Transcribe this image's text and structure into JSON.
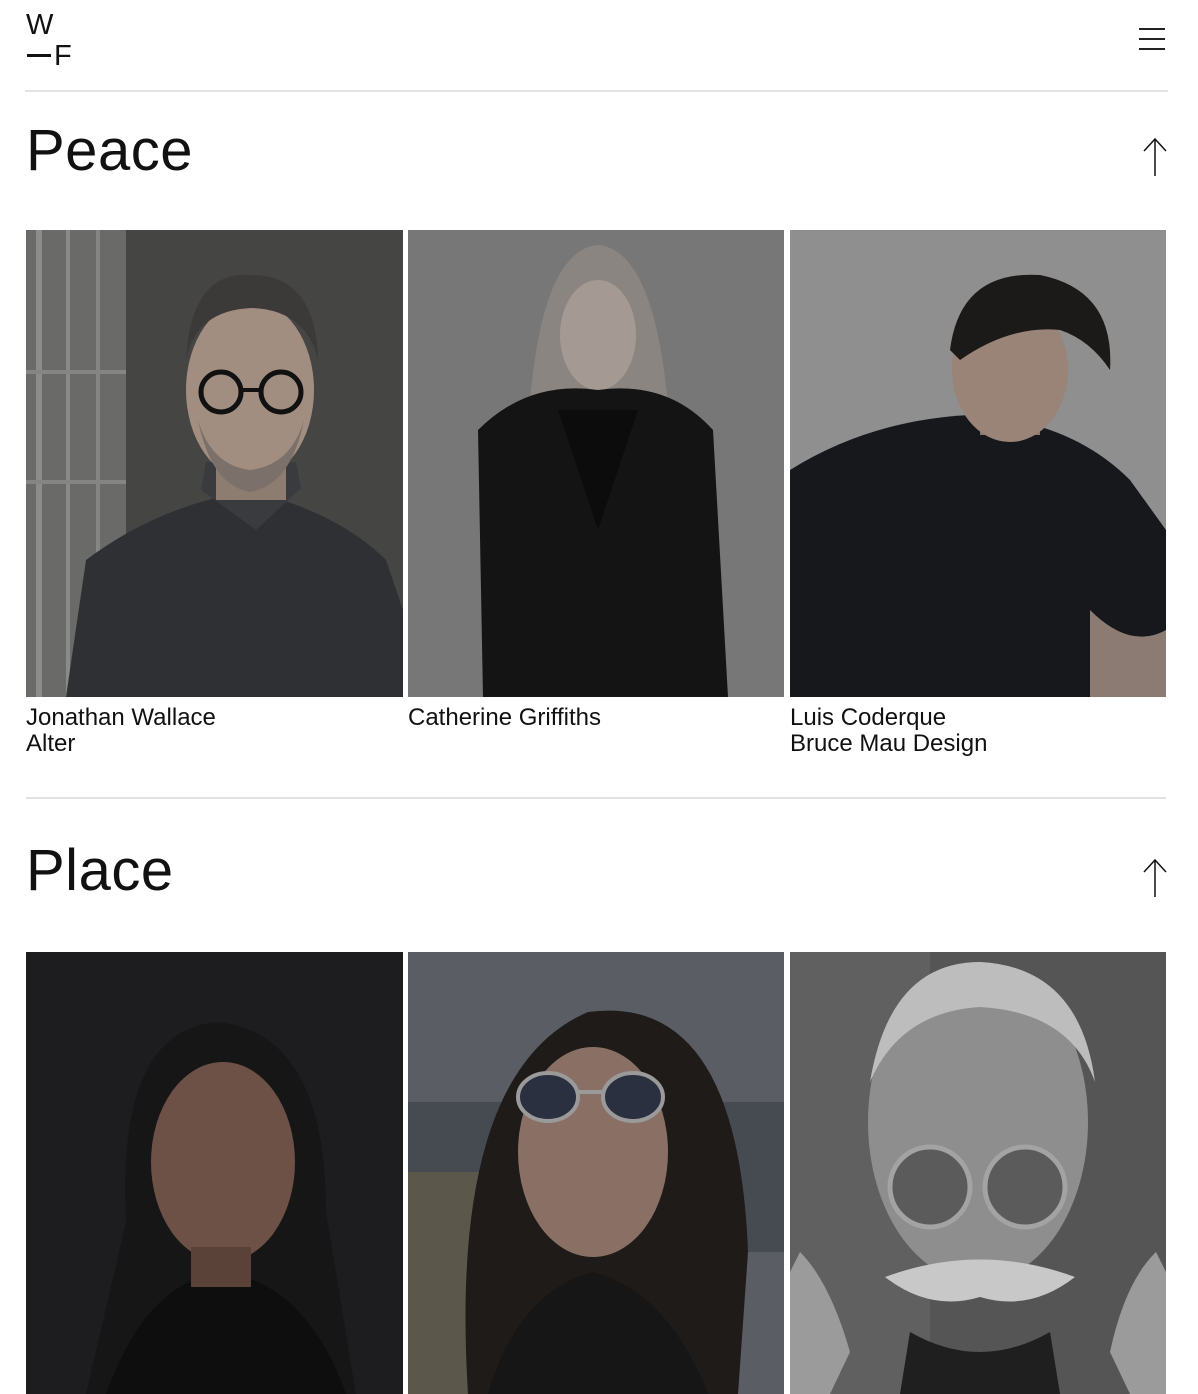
{
  "logo": {
    "top": "W",
    "bottom": "F"
  },
  "sections": [
    {
      "title": "Peace",
      "people": [
        {
          "name": "Jonathan Wallace",
          "company": "Alter"
        },
        {
          "name": "Catherine Griffiths",
          "company": ""
        },
        {
          "name": "Luis Coderque",
          "company": "Bruce Mau Design"
        }
      ]
    },
    {
      "title": "Place",
      "people": [
        {
          "name": "",
          "company": ""
        },
        {
          "name": "",
          "company": ""
        },
        {
          "name": "",
          "company": ""
        }
      ]
    }
  ]
}
